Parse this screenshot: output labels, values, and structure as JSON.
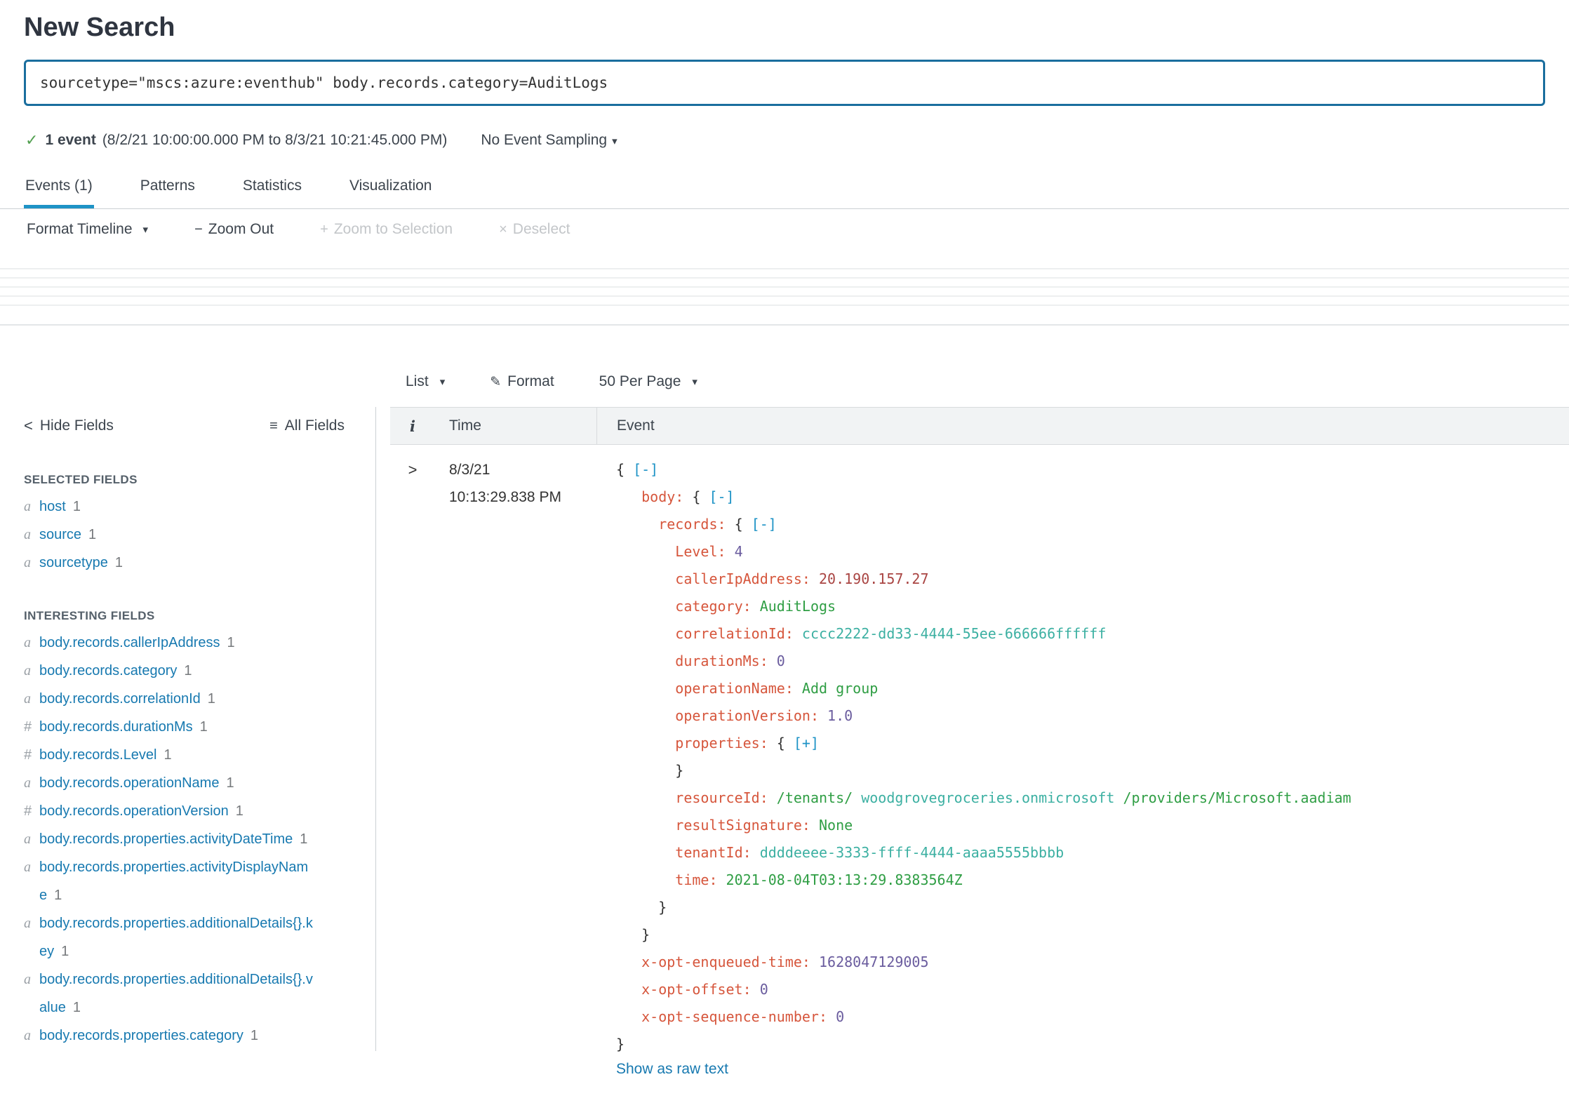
{
  "page": {
    "title": "New Search"
  },
  "search": {
    "query": "sourcetype=\"mscs:azure:eventhub\" body.records.category=AuditLogs"
  },
  "results": {
    "count_label": "1 event",
    "range_label": "(8/2/21 10:00:00.000 PM to 8/3/21 10:21:45.000 PM)",
    "sampling_label": "No Event Sampling"
  },
  "tabs": [
    {
      "id": "events",
      "label": "Events (1)",
      "active": true
    },
    {
      "id": "patterns",
      "label": "Patterns",
      "active": false
    },
    {
      "id": "statistics",
      "label": "Statistics",
      "active": false
    },
    {
      "id": "visualization",
      "label": "Visualization",
      "active": false
    }
  ],
  "timeline_controls": {
    "format_timeline": "Format Timeline",
    "zoom_out": "Zoom Out",
    "zoom_to_selection": "Zoom to Selection",
    "deselect": "Deselect"
  },
  "list_controls": {
    "list": "List",
    "format": "Format",
    "per_page": "50 Per Page"
  },
  "fields_panel": {
    "hide_fields": "Hide Fields",
    "all_fields": "All Fields",
    "selected_header": "SELECTED FIELDS",
    "interesting_header": "INTERESTING FIELDS",
    "selected": [
      {
        "type": "a",
        "name": "host",
        "count": "1"
      },
      {
        "type": "a",
        "name": "source",
        "count": "1"
      },
      {
        "type": "a",
        "name": "sourcetype",
        "count": "1"
      }
    ],
    "interesting": [
      {
        "type": "a",
        "name": "body.records.callerIpAddress",
        "count": "1"
      },
      {
        "type": "a",
        "name": "body.records.category",
        "count": "1"
      },
      {
        "type": "a",
        "name": "body.records.correlationId",
        "count": "1"
      },
      {
        "type": "#",
        "name": "body.records.durationMs",
        "count": "1"
      },
      {
        "type": "#",
        "name": "body.records.Level",
        "count": "1"
      },
      {
        "type": "a",
        "name": "body.records.operationName",
        "count": "1"
      },
      {
        "type": "#",
        "name": "body.records.operationVersion",
        "count": "1"
      },
      {
        "type": "a",
        "name": "body.records.properties.activityDateTime",
        "count": "1"
      },
      {
        "type": "a",
        "name": "body.records.properties.activityDisplayName",
        "count": "1"
      },
      {
        "type": "a",
        "name": "body.records.properties.additionalDetails{}.key",
        "count": "1"
      },
      {
        "type": "a",
        "name": "body.records.properties.additionalDetails{}.value",
        "count": "1"
      },
      {
        "type": "a",
        "name": "body.records.properties.category",
        "count": "1"
      }
    ]
  },
  "events_table": {
    "headers": {
      "info": "i",
      "time": "Time",
      "event": "Event"
    },
    "row": {
      "date": "8/3/21",
      "time": "10:13:29.838 PM",
      "raw_link": "Show as raw text",
      "json_lines": [
        {
          "ind": 0,
          "seg": [
            [
              "p",
              "{ "
            ],
            [
              "t",
              "[-]"
            ]
          ]
        },
        {
          "ind": 3,
          "seg": [
            [
              "k",
              "body: "
            ],
            [
              "p",
              "{ "
            ],
            [
              "t",
              "[-]"
            ]
          ]
        },
        {
          "ind": 5,
          "seg": [
            [
              "k",
              "records: "
            ],
            [
              "p",
              "{ "
            ],
            [
              "t",
              "[-]"
            ]
          ]
        },
        {
          "ind": 7,
          "seg": [
            [
              "k",
              "Level: "
            ],
            [
              "n",
              "4"
            ]
          ]
        },
        {
          "ind": 7,
          "seg": [
            [
              "k",
              "callerIpAddress: "
            ],
            [
              "ip",
              "20.190.157.27"
            ]
          ]
        },
        {
          "ind": 7,
          "seg": [
            [
              "k",
              "category: "
            ],
            [
              "s",
              "AuditLogs"
            ]
          ]
        },
        {
          "ind": 7,
          "seg": [
            [
              "k",
              "correlationId: "
            ],
            [
              "h",
              "cccc2222-dd33-4444-55ee-666666ffffff"
            ]
          ]
        },
        {
          "ind": 7,
          "seg": [
            [
              "k",
              "durationMs: "
            ],
            [
              "n",
              "0"
            ]
          ]
        },
        {
          "ind": 7,
          "seg": [
            [
              "k",
              "operationName: "
            ],
            [
              "s",
              "Add group"
            ]
          ]
        },
        {
          "ind": 7,
          "seg": [
            [
              "k",
              "operationVersion: "
            ],
            [
              "n",
              "1.0"
            ]
          ]
        },
        {
          "ind": 7,
          "seg": [
            [
              "k",
              "properties: "
            ],
            [
              "p",
              "{ "
            ],
            [
              "t",
              "[+]"
            ]
          ]
        },
        {
          "ind": 7,
          "seg": [
            [
              "p",
              "}"
            ]
          ]
        },
        {
          "ind": 7,
          "seg": [
            [
              "k",
              "resourceId: "
            ],
            [
              "s",
              "/tenants/ "
            ],
            [
              "h",
              "woodgrovegroceries.onmicrosoft "
            ],
            [
              "s",
              "/providers/Microsoft.aadiam"
            ]
          ]
        },
        {
          "ind": 7,
          "seg": [
            [
              "k",
              "resultSignature: "
            ],
            [
              "s",
              "None"
            ]
          ]
        },
        {
          "ind": 7,
          "seg": [
            [
              "k",
              "tenantId: "
            ],
            [
              "h",
              "ddddeeee-3333-ffff-4444-aaaa5555bbbb"
            ]
          ]
        },
        {
          "ind": 7,
          "seg": [
            [
              "k",
              "time: "
            ],
            [
              "s",
              "2021-08-04T03:13:29.8383564Z"
            ]
          ]
        },
        {
          "ind": 5,
          "seg": [
            [
              "p",
              "}"
            ]
          ]
        },
        {
          "ind": 3,
          "seg": [
            [
              "p",
              "}"
            ]
          ]
        },
        {
          "ind": 3,
          "seg": [
            [
              "k",
              "x-opt-enqueued-time: "
            ],
            [
              "n",
              "1628047129005"
            ]
          ]
        },
        {
          "ind": 3,
          "seg": [
            [
              "k",
              "x-opt-offset: "
            ],
            [
              "n",
              "0"
            ]
          ]
        },
        {
          "ind": 3,
          "seg": [
            [
              "k",
              "x-opt-sequence-number: "
            ],
            [
              "n",
              "0"
            ]
          ]
        },
        {
          "ind": 0,
          "seg": [
            [
              "p",
              "}"
            ]
          ]
        }
      ]
    }
  },
  "icons": {
    "check": "✓",
    "caret_down": "▾",
    "chevron_left": "<",
    "list_menu": "≡",
    "pencil": "✎",
    "minus": "−",
    "plus": "+",
    "x": "×",
    "expander": ">",
    "info": "i"
  },
  "colors": {
    "text": "#3c444d",
    "accent": "#1e93c6",
    "link": "#1779b0",
    "search_border": "#1a6e9e",
    "key": "#d6563c",
    "str": "#2f9e44",
    "num": "#6a5c9e",
    "teal": "#3cb0a2",
    "ip": "#a94442",
    "toggle": "#1e93c6",
    "check": "#53a051",
    "disabled": "#c3c6c9",
    "header_bg": "#f1f3f4",
    "border_col": "#d8dbdd"
  }
}
